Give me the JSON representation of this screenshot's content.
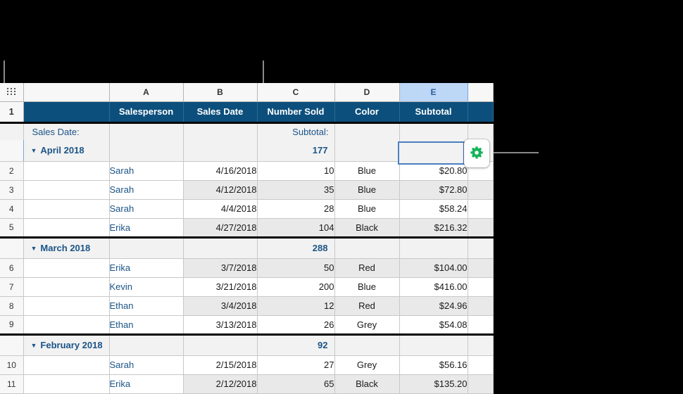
{
  "colors": {
    "header_navy": "#0c4f7c",
    "accent_blue_text": "#1b5486",
    "selection_blue": "#bdd7f7",
    "selected_cell_border": "#4a7fc1",
    "gear_green": "#16b45a",
    "band_grey": "#e9e9e9",
    "group_row_grey": "#f2f2f2"
  },
  "column_headers": {
    "corner_icon": "table-handle-icon",
    "letters": [
      "A",
      "B",
      "C",
      "D",
      "E",
      ""
    ],
    "selected_letter": "E"
  },
  "table": {
    "header_labels": [
      "",
      "Salesperson",
      "Sales Date",
      "Number Sold",
      "Color",
      "Subtotal",
      ""
    ],
    "category_label": "Sales Date:",
    "subtotal_label": "Subtotal:",
    "row_number_header": "1"
  },
  "groups": [
    {
      "name": "April 2018",
      "disclosure": "▼",
      "total": "177",
      "rows": [
        {
          "num": "2",
          "salesperson": "Sarah",
          "date": "4/16/2018",
          "number_sold": "10",
          "color": "Blue",
          "subtotal": "$20.80"
        },
        {
          "num": "3",
          "salesperson": "Sarah",
          "date": "4/12/2018",
          "number_sold": "35",
          "color": "Blue",
          "subtotal": "$72.80"
        },
        {
          "num": "4",
          "salesperson": "Sarah",
          "date": "4/4/2018",
          "number_sold": "28",
          "color": "Blue",
          "subtotal": "$58.24"
        },
        {
          "num": "5",
          "salesperson": "Erika",
          "date": "4/27/2018",
          "number_sold": "104",
          "color": "Black",
          "subtotal": "$216.32"
        }
      ]
    },
    {
      "name": "March 2018",
      "disclosure": "▼",
      "total": "288",
      "rows": [
        {
          "num": "6",
          "salesperson": "Erika",
          "date": "3/7/2018",
          "number_sold": "50",
          "color": "Red",
          "subtotal": "$104.00"
        },
        {
          "num": "7",
          "salesperson": "Kevin",
          "date": "3/21/2018",
          "number_sold": "200",
          "color": "Blue",
          "subtotal": "$416.00"
        },
        {
          "num": "8",
          "salesperson": "Ethan",
          "date": "3/4/2018",
          "number_sold": "12",
          "color": "Red",
          "subtotal": "$24.96"
        },
        {
          "num": "9",
          "salesperson": "Ethan",
          "date": "3/13/2018",
          "number_sold": "26",
          "color": "Grey",
          "subtotal": "$54.08"
        }
      ]
    },
    {
      "name": "February 2018",
      "disclosure": "▼",
      "total": "92",
      "rows": [
        {
          "num": "10",
          "salesperson": "Sarah",
          "date": "2/15/2018",
          "number_sold": "27",
          "color": "Grey",
          "subtotal": "$56.16"
        },
        {
          "num": "11",
          "salesperson": "Erika",
          "date": "2/12/2018",
          "number_sold": "65",
          "color": "Black",
          "subtotal": "$135.20"
        }
      ]
    }
  ],
  "gear_button": {
    "icon": "gear-icon"
  }
}
